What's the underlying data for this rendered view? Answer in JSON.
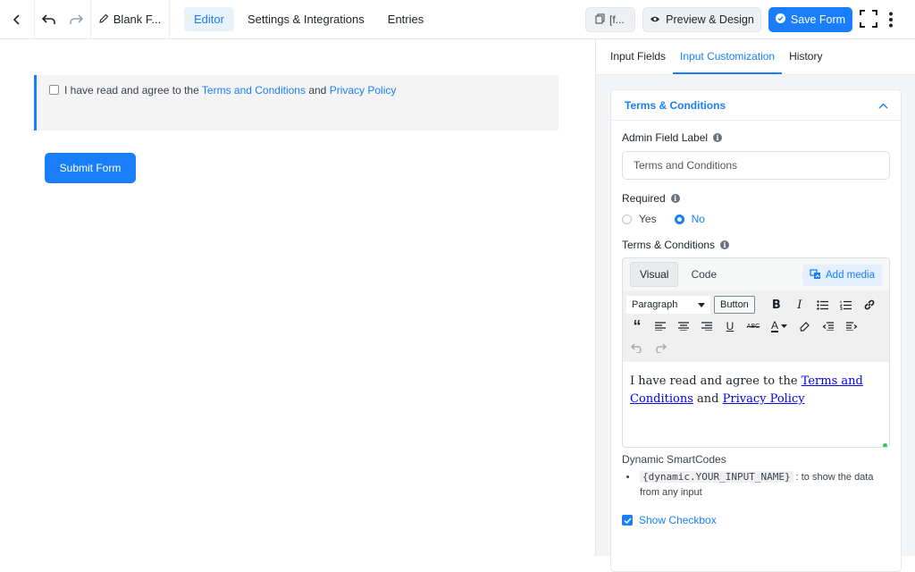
{
  "topbar": {
    "title": "Blank F...",
    "tabs": [
      {
        "label": "Editor",
        "active": true
      },
      {
        "label": "Settings & Integrations",
        "active": false
      },
      {
        "label": "Entries",
        "active": false
      }
    ],
    "shortcode_label": "[f...",
    "preview_label": "Preview & Design",
    "save_label": "Save Form"
  },
  "canvas": {
    "checkbox_prefix": "I have read and agree to the",
    "link_terms": "Terms and Conditions",
    "conjunction": "and",
    "link_privacy": "Privacy Policy",
    "submit_label": "Submit Form"
  },
  "panel": {
    "tabs": [
      {
        "label": "Input Fields",
        "active": false
      },
      {
        "label": "Input Customization",
        "active": true
      },
      {
        "label": "History",
        "active": false
      }
    ],
    "section_title": "Terms & Conditions",
    "admin_label_title": "Admin Field Label",
    "admin_label_value": "Terms and Conditions",
    "required_title": "Required",
    "required_options": [
      {
        "label": "Yes",
        "selected": false
      },
      {
        "label": "No",
        "selected": true
      }
    ],
    "tc_title": "Terms & Conditions",
    "editor": {
      "tab_visual": "Visual",
      "tab_code": "Code",
      "add_media": "Add media",
      "format_select": "Paragraph",
      "button_label": "Button",
      "content_prefix": "I have read and agree to the",
      "content_link1": "Terms and Conditions",
      "content_mid": "and",
      "content_link2": "Privacy Policy"
    },
    "smartcodes_title": "Dynamic SmartCodes",
    "smartcode": "{dynamic.YOUR_INPUT_NAME}",
    "smartcode_desc": ": to show the data from any input",
    "show_checkbox_label": "Show Checkbox"
  },
  "colors": {
    "accent": "#1a7efb",
    "panel_bg": "#f3f4f6",
    "success": "#36c55b"
  }
}
